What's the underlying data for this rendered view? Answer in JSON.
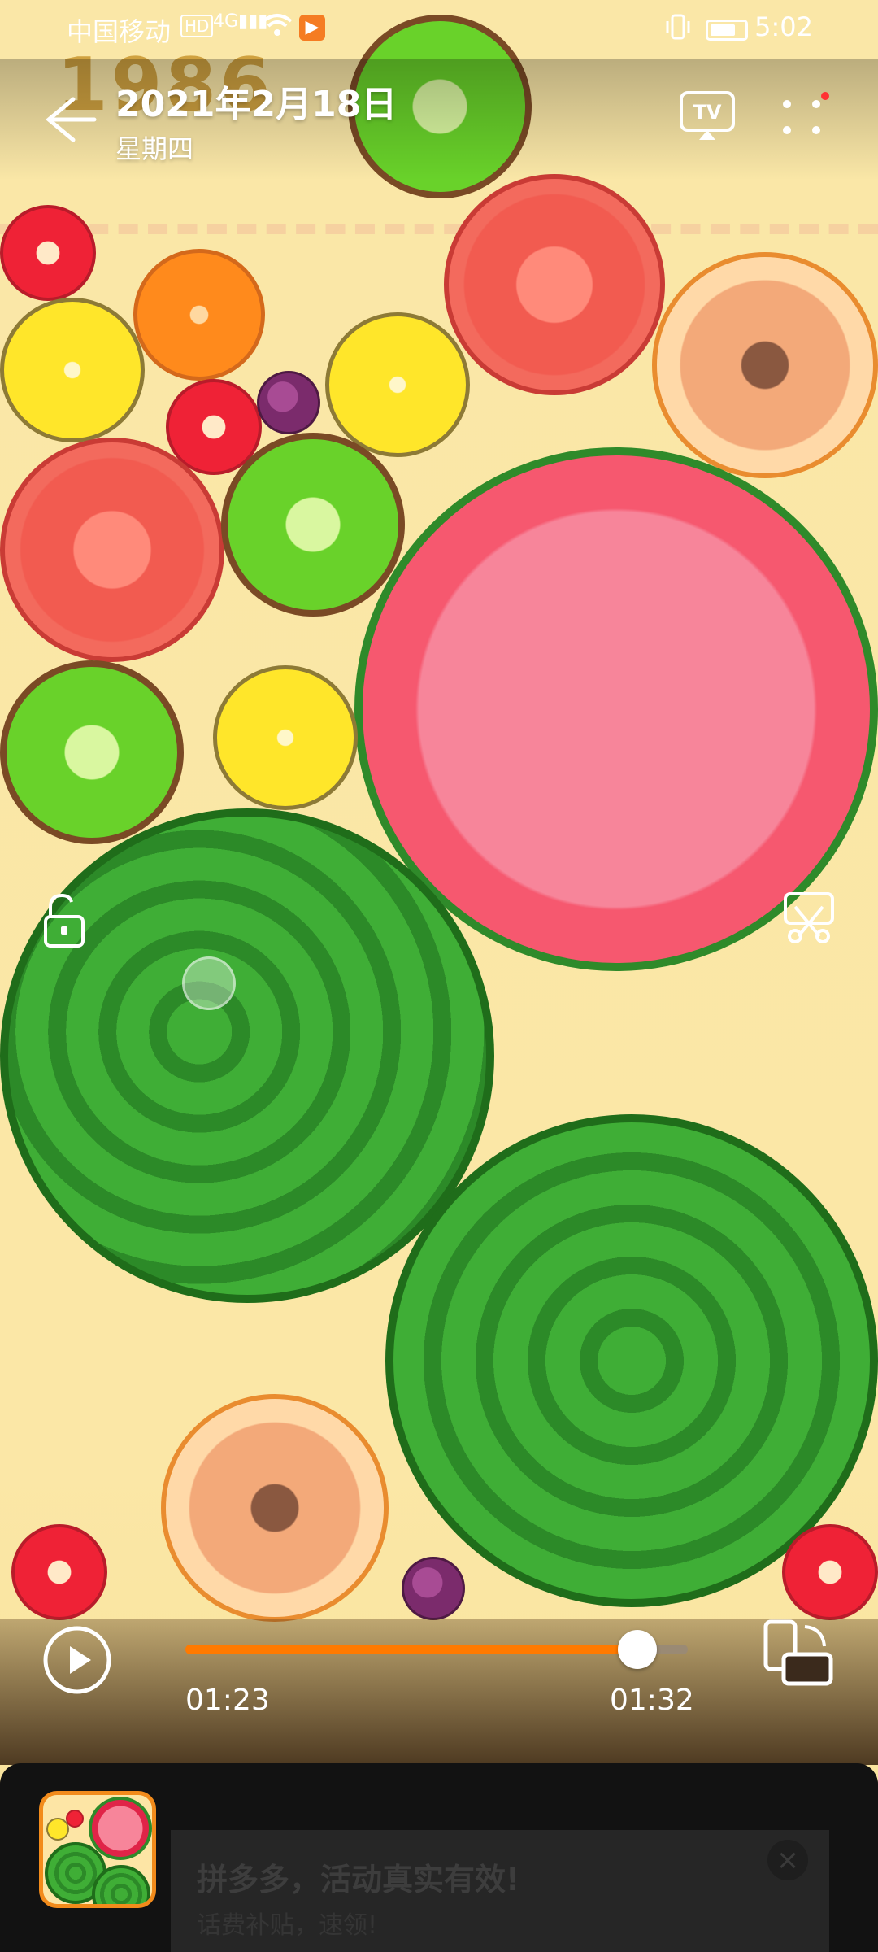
{
  "status_bar": {
    "carrier": "中国移动",
    "hd_label": "HD",
    "network": "4G",
    "time": "5:02"
  },
  "header": {
    "title": "2021年2月18日",
    "subtitle": "星期四",
    "tv_label": "TV"
  },
  "game": {
    "score": "1986",
    "fruits": [
      "watermelon-slice",
      "watermelon",
      "watermelon",
      "tomato",
      "tomato",
      "kiwi",
      "kiwi",
      "kiwi",
      "lemon",
      "lemon",
      "lemon",
      "orange",
      "peach",
      "peach",
      "strawberry",
      "strawberry",
      "strawberry",
      "strawberry",
      "grape",
      "grape"
    ]
  },
  "player": {
    "current_time": "01:23",
    "total_time": "01:32",
    "progress_percent": 90,
    "accent": "#ff7a00"
  },
  "ad": {
    "title": "拼多多，活动真实有效!",
    "subtitle": "话费补贴，速领!",
    "close_glyph": "×"
  }
}
